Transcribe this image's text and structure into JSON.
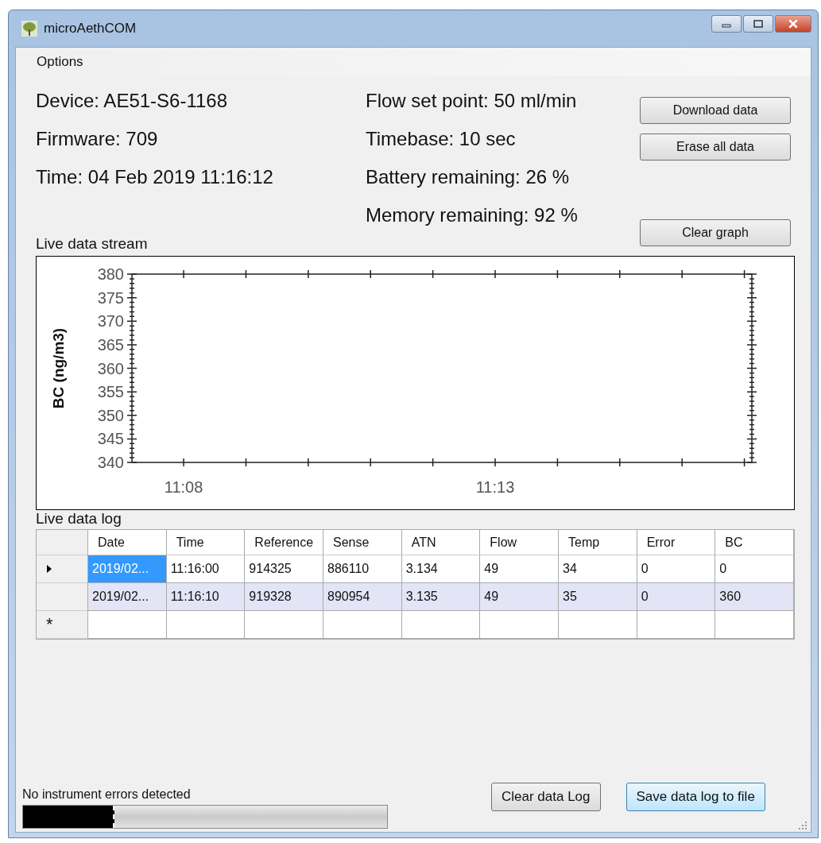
{
  "window": {
    "title": "microAethCOM"
  },
  "menu": [
    {
      "label": "Options"
    }
  ],
  "info_left": [
    "Device: AE51-S6-1168",
    "Firmware: 709",
    "Time: 04 Feb 2019 11:16:12"
  ],
  "info_right": [
    "Flow set point: 50 ml/min",
    "Timebase: 10 sec",
    "Battery remaining: 26 %",
    "Memory remaining: 92 %"
  ],
  "buttons_top": [
    "Download data",
    "Erase all data"
  ],
  "clear_graph_button": "Clear graph",
  "stream": {
    "label": "Live data stream",
    "chart_data": {
      "type": "line",
      "ylabel": "BC (ng/m3)",
      "ylim": [
        340,
        380
      ],
      "yticks": [
        340,
        345,
        350,
        355,
        360,
        365,
        370,
        375,
        380
      ],
      "xlim": [
        667.17,
        677.12
      ],
      "xticks": [
        {
          "value": 668,
          "label": "11:08"
        },
        {
          "value": 673,
          "label": "11:13"
        }
      ]
    }
  },
  "log": {
    "label": "Live data log",
    "columns": [
      "Date",
      "Time",
      "Reference",
      "Sense",
      "ATN",
      "Flow",
      "Temp",
      "Error",
      "BC"
    ],
    "rows": [
      {
        "selected": true,
        "shaded": false,
        "cells": [
          "2019/02...",
          "11:16:00",
          "914325",
          "886110",
          "3.134",
          "49",
          "34",
          "0",
          "0"
        ]
      },
      {
        "selected": false,
        "shaded": true,
        "cells": [
          "2019/02...",
          "11:16:10",
          "919328",
          "890954",
          "3.135",
          "49",
          "35",
          "0",
          "360"
        ]
      }
    ],
    "new_row_marker": "*"
  },
  "status": {
    "text": "No instrument errors detected",
    "level": 0.25
  },
  "buttons_bottom": [
    {
      "label": "Clear data Log",
      "focused": false
    },
    {
      "label": "Save data log to file",
      "focused": true
    }
  ]
}
